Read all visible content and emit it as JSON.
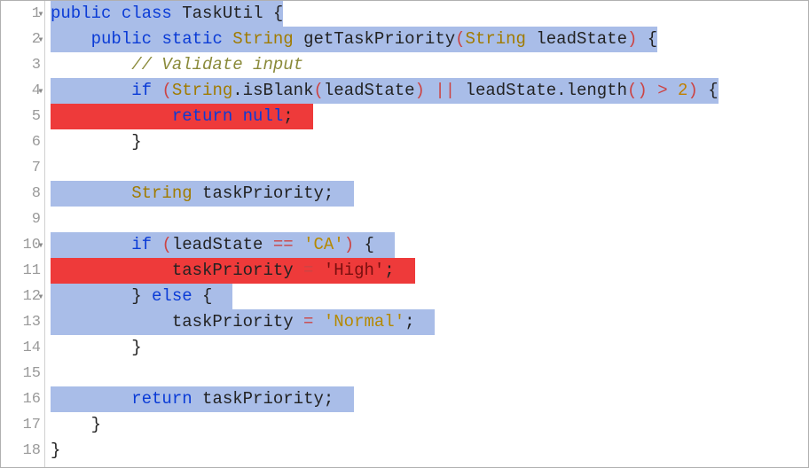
{
  "language": "apex",
  "className": "TaskUtil",
  "lines": [
    {
      "n": 1,
      "fold": true
    },
    {
      "n": 2,
      "fold": true
    },
    {
      "n": 3,
      "fold": false
    },
    {
      "n": 4,
      "fold": true
    },
    {
      "n": 5,
      "fold": false
    },
    {
      "n": 6,
      "fold": false
    },
    {
      "n": 7,
      "fold": false
    },
    {
      "n": 8,
      "fold": false
    },
    {
      "n": 9,
      "fold": false
    },
    {
      "n": 10,
      "fold": true
    },
    {
      "n": 11,
      "fold": false
    },
    {
      "n": 12,
      "fold": true
    },
    {
      "n": 13,
      "fold": false
    },
    {
      "n": 14,
      "fold": false
    },
    {
      "n": 15,
      "fold": false
    },
    {
      "n": 16,
      "fold": false
    },
    {
      "n": 17,
      "fold": false
    },
    {
      "n": 18,
      "fold": false
    }
  ],
  "tok": {
    "kw_public": "public",
    "kw_class": "class",
    "kw_static": "static",
    "kw_if": "if",
    "kw_else": "else",
    "kw_return": "return",
    "kw_null": "null",
    "cls_String": "String",
    "id_TaskUtil": "TaskUtil",
    "id_getTaskPriority": "getTaskPriority",
    "id_leadState": "leadState",
    "id_taskPriority": "taskPriority",
    "meth_isBlank": "isBlank",
    "meth_length": "length",
    "cmt_validate": "// Validate input",
    "str_CA": "'CA'",
    "str_High": "'High'",
    "str_Normal": "'Normal'",
    "num_2": "2",
    "lbrace": "{",
    "rbrace": "}",
    "lparen": "(",
    "rparen": ")",
    "dot": ".",
    "comma": ",",
    "semi": ";",
    "assign": " = ",
    "eqeq": " == ",
    "oror": " || ",
    "gt": " > ",
    "sp": " "
  },
  "highlights": {
    "blue": "#a9bde8",
    "red": "#ee3a3a"
  },
  "coverage": {
    "uncovered_lines": [
      5,
      11
    ],
    "covered_lines": [
      1,
      2,
      4,
      8,
      10,
      12,
      13,
      16
    ]
  }
}
